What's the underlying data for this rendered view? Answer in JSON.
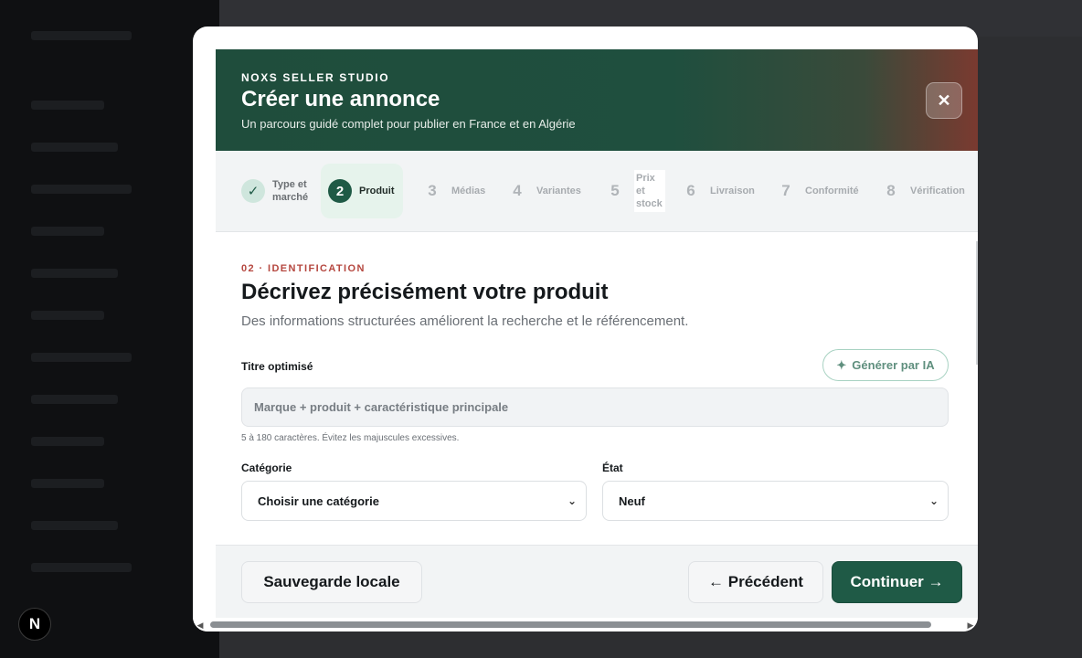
{
  "app": {
    "badge": "N"
  },
  "modal": {
    "brand": "NOXS SELLER STUDIO",
    "title": "Créer une annonce",
    "subtitle": "Un parcours guidé complet pour publier en France et en Algérie",
    "close_label": "✕"
  },
  "steps": [
    {
      "num": "✓",
      "label": "Type et marché",
      "state": "done"
    },
    {
      "num": "2",
      "label": "Produit",
      "state": "active"
    },
    {
      "num": "3",
      "label": "Médias",
      "state": "todo"
    },
    {
      "num": "4",
      "label": "Variantes",
      "state": "todo"
    },
    {
      "num": "5",
      "label": "Prix et stock",
      "state": "todo"
    },
    {
      "num": "6",
      "label": "Livraison",
      "state": "todo"
    },
    {
      "num": "7",
      "label": "Conformité",
      "state": "todo"
    },
    {
      "num": "8",
      "label": "Vérification",
      "state": "todo"
    }
  ],
  "section": {
    "eyebrow": "02 · IDENTIFICATION",
    "heading": "Décrivez précisément votre produit",
    "lead": "Des informations structurées améliorent la recherche et le référencement."
  },
  "form": {
    "title_label": "Titre optimisé",
    "ai_button": "Générer par IA",
    "ai_icon": "✦",
    "title_value": "",
    "title_placeholder": "Marque + produit + caractéristique principale",
    "title_hint": "5 à 180 caractères. Évitez les majuscules excessives.",
    "category_label": "Catégorie",
    "category_value": "Choisir une catégorie",
    "condition_label": "État",
    "condition_value": "Neuf"
  },
  "footer": {
    "save_local": "Sauvegarde locale",
    "previous": "← Précédent",
    "continue": "Continuer →"
  },
  "colors": {
    "brand_green": "#1f5a46",
    "accent_red": "#b5473f"
  }
}
